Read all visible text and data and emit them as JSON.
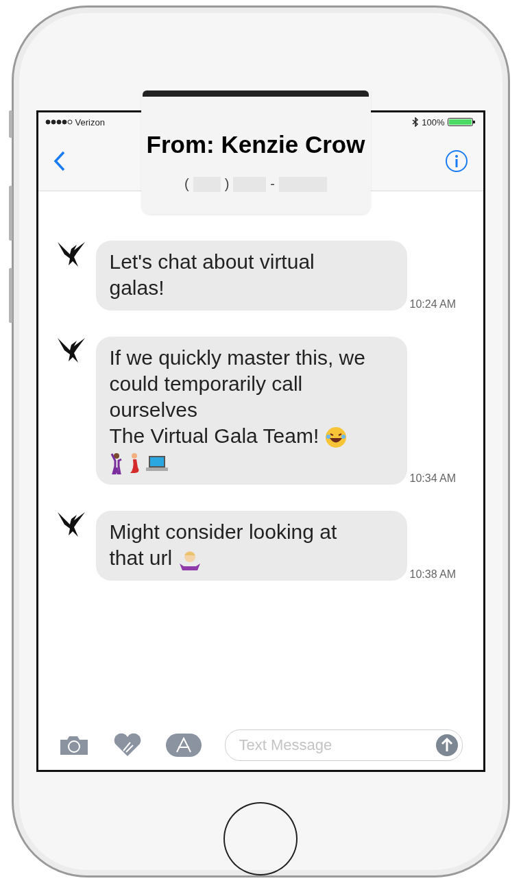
{
  "status_bar": {
    "carrier": "Verizon",
    "battery": "100%",
    "level": 1
  },
  "header": {
    "title": "From: Kenzie Crow",
    "phone_parts": [
      "(",
      ")",
      "-"
    ]
  },
  "messages": [
    {
      "time": "10:24 AM",
      "parts": [
        {
          "kind": "text",
          "text": "Let's chat about virtual galas!"
        }
      ]
    },
    {
      "time": "10:34 AM",
      "parts": [
        {
          "kind": "text",
          "text": "If we quickly master this, we could temporarily call ourselves"
        },
        {
          "kind": "break"
        },
        {
          "kind": "text",
          "text": "The Virtual Gala Team! "
        },
        {
          "kind": "laughing-face"
        },
        {
          "kind": "break"
        },
        {
          "kind": "man-dancing"
        },
        {
          "kind": "woman-dancing"
        },
        {
          "kind": "laptop"
        }
      ]
    },
    {
      "time": "10:38 AM",
      "parts": [
        {
          "kind": "text",
          "text": "Might consider looking at that url "
        },
        {
          "kind": "shrug"
        }
      ]
    }
  ],
  "composer": {
    "placeholder": "Text Message"
  }
}
